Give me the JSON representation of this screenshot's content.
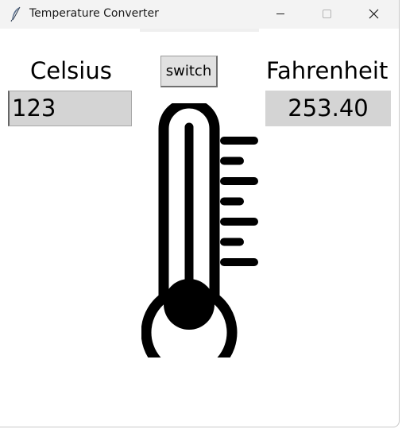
{
  "window": {
    "title": "Temperature Converter",
    "controls": {
      "minimize_icon": "minimize-icon",
      "maximize_icon": "maximize-icon",
      "close_icon": "close-icon"
    }
  },
  "converter": {
    "left_label": "Celsius",
    "right_label": "Fahrenheit",
    "switch_label": "switch",
    "celsius_value": "123",
    "fahrenheit_value": "253.40"
  },
  "graphic": {
    "icon": "thermometer-icon",
    "tick_count": 7
  },
  "colors": {
    "titlebar": "#f3f3f3",
    "entry_background": "#d4d4d4",
    "button_background": "#e1e1e1",
    "icon": "#000000"
  }
}
